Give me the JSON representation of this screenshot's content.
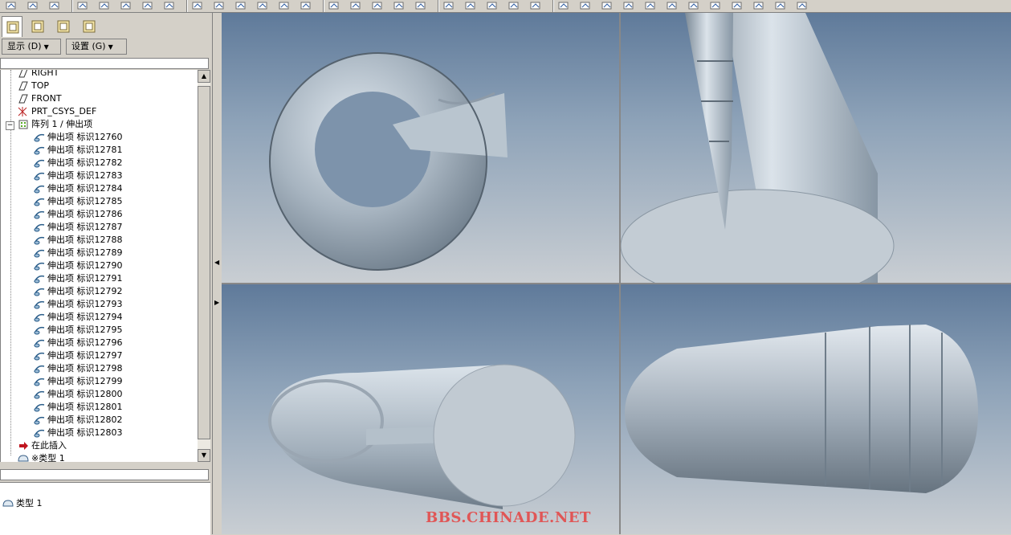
{
  "toolbar": {
    "icons": [
      "new-icon",
      "open-icon",
      "save-icon",
      "regenerate-icon",
      "copy-icon",
      "paste-icon",
      "paste-special-icon",
      "status-icon",
      "select-box-icon",
      "sketch-icon",
      "zoom-in-icon",
      "zoom-out-icon",
      "refit-icon",
      "view-icon",
      "layers-icon",
      "shading-icon",
      "wireframe-icon",
      "hidden-line-icon",
      "no-hidden-icon",
      "shaded-icon",
      "view-manager-icon",
      "datum-plane-icon",
      "datum-axis-icon",
      "datum-point-icon",
      "datum-csys-icon",
      "analysis-icon",
      "feature-tool-icon",
      "sweep-icon",
      "blend-icon",
      "revolve-icon",
      "extrude-icon",
      "hole-icon",
      "round-icon",
      "chamfer-icon",
      "draft-icon",
      "shell-icon"
    ]
  },
  "nav_tabs": [
    "model-tree-tab",
    "folder-browser-tab",
    "favorites-tab",
    "connections-tab"
  ],
  "menu": {
    "display_label": "显示 (D)",
    "settings_label": "设置 (G)"
  },
  "tree": {
    "items": [
      {
        "label": "RIGHT",
        "icon": "datum-plane-icon",
        "indent": 20
      },
      {
        "label": "TOP",
        "icon": "datum-plane-icon",
        "indent": 20
      },
      {
        "label": "FRONT",
        "icon": "datum-plane-icon",
        "indent": 20
      },
      {
        "label": "PRT_CSYS_DEF",
        "icon": "csys-icon",
        "indent": 20
      },
      {
        "label": "阵列 1 / 伸出项",
        "icon": "pattern-icon",
        "indent": 20
      },
      {
        "label": "伸出项 标识12760",
        "icon": "protrusion-icon",
        "indent": 40
      },
      {
        "label": "伸出项 标识12781",
        "icon": "protrusion-icon",
        "indent": 40
      },
      {
        "label": "伸出项 标识12782",
        "icon": "protrusion-icon",
        "indent": 40
      },
      {
        "label": "伸出项 标识12783",
        "icon": "protrusion-icon",
        "indent": 40
      },
      {
        "label": "伸出项 标识12784",
        "icon": "protrusion-icon",
        "indent": 40
      },
      {
        "label": "伸出项 标识12785",
        "icon": "protrusion-icon",
        "indent": 40
      },
      {
        "label": "伸出项 标识12786",
        "icon": "protrusion-icon",
        "indent": 40
      },
      {
        "label": "伸出项 标识12787",
        "icon": "protrusion-icon",
        "indent": 40
      },
      {
        "label": "伸出项 标识12788",
        "icon": "protrusion-icon",
        "indent": 40
      },
      {
        "label": "伸出项 标识12789",
        "icon": "protrusion-icon",
        "indent": 40
      },
      {
        "label": "伸出项 标识12790",
        "icon": "protrusion-icon",
        "indent": 40
      },
      {
        "label": "伸出项 标识12791",
        "icon": "protrusion-icon",
        "indent": 40
      },
      {
        "label": "伸出项 标识12792",
        "icon": "protrusion-icon",
        "indent": 40
      },
      {
        "label": "伸出项 标识12793",
        "icon": "protrusion-icon",
        "indent": 40
      },
      {
        "label": "伸出项 标识12794",
        "icon": "protrusion-icon",
        "indent": 40
      },
      {
        "label": "伸出项 标识12795",
        "icon": "protrusion-icon",
        "indent": 40
      },
      {
        "label": "伸出项 标识12796",
        "icon": "protrusion-icon",
        "indent": 40
      },
      {
        "label": "伸出项 标识12797",
        "icon": "protrusion-icon",
        "indent": 40
      },
      {
        "label": "伸出项 标识12798",
        "icon": "protrusion-icon",
        "indent": 40
      },
      {
        "label": "伸出项 标识12799",
        "icon": "protrusion-icon",
        "indent": 40
      },
      {
        "label": "伸出项 标识12800",
        "icon": "protrusion-icon",
        "indent": 40
      },
      {
        "label": "伸出项 标识12801",
        "icon": "protrusion-icon",
        "indent": 40
      },
      {
        "label": "伸出项 标识12802",
        "icon": "protrusion-icon",
        "indent": 40
      },
      {
        "label": "伸出项 标识12803",
        "icon": "protrusion-icon",
        "indent": 40
      },
      {
        "label": "在此插入",
        "icon": "insert-here-icon",
        "indent": 20
      },
      {
        "label": "※类型 1",
        "icon": "layer-icon",
        "indent": 20
      }
    ]
  },
  "layers": {
    "items": [
      {
        "label": "类型 1",
        "icon": "layer-icon"
      }
    ]
  },
  "watermark": "BBS.CHINADE.NET",
  "colors": {
    "panel": "#d4d0c8",
    "model": "#a9b6c2",
    "watermark": "#e05656"
  }
}
